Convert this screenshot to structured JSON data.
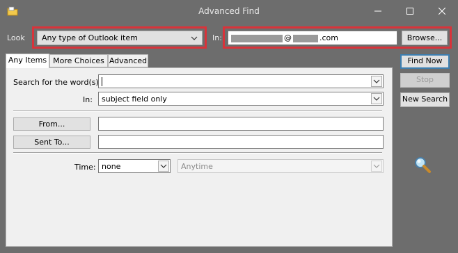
{
  "window": {
    "title": "Advanced Find",
    "icon": "outlook-folder-icon"
  },
  "look": {
    "label": "Look",
    "value": "Any type of Outlook item"
  },
  "in": {
    "label": "In:",
    "email_at": "@",
    "email_suffix": ".com",
    "browse_label": "Browse..."
  },
  "actions": {
    "find_now": "Find Now",
    "stop": "Stop",
    "new_search": "New Search"
  },
  "tabs": [
    {
      "label": "Any Items",
      "active": true
    },
    {
      "label": "More Choices",
      "active": false
    },
    {
      "label": "Advanced",
      "active": false
    }
  ],
  "form": {
    "search_label": "Search for the word(s):",
    "search_value": "",
    "in_label": "In:",
    "in_value": "subject field only",
    "from_button": "From...",
    "from_value": "",
    "sent_to_button": "Sent To...",
    "sent_to_value": "",
    "time_label": "Time:",
    "time_value": "none",
    "time_range_value": "Anytime"
  },
  "colors": {
    "highlight": "#d9333a",
    "chrome": "#6d6d6d",
    "panel": "#f0f0f0",
    "default_button_border": "#3c7fb1"
  }
}
